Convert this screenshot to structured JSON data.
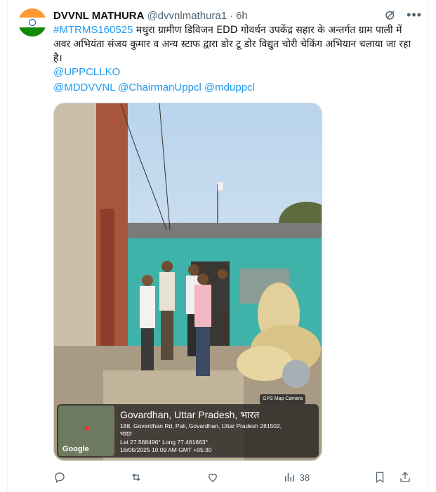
{
  "tweet": {
    "author_name": "DVVNL MATHURA",
    "author_handle": "@dvvnlmathura1",
    "separator": "·",
    "time": "6h",
    "hashtag": "#MTRMS160525",
    "body": "मथुरा ग्रामीण डिविजन EDD गोवर्धन उपकेंद्र सहार के अन्तर्गत ग्राम पाली में अवर अभियंता संजय कुमार व अन्य स्टाफ द्वारा डोर टू डोर विद्युत चोरी चेकिंग अभियान चलाया जा रहा है।",
    "mention_line_1": "@UPPCLLKO",
    "mention_line_2": "@MDDVVNL @ChairmanUppcl @mduppcl"
  },
  "photo_overlay": {
    "badge": "GPS Map Camera",
    "place": "Govardhan, Uttar Pradesh, भारत",
    "address": "188, Goverdhan Rd, Pali, Govardhan, Uttar Pradesh 281502,",
    "address_2": "भारत",
    "latlong": "Lat 27.568496° Long 77.461663°",
    "datetime": "16/05/2025 10:09 AM GMT +05:30",
    "map_logo": "Google"
  },
  "actions": {
    "views_count": "38"
  },
  "colors": {
    "link": "#1d9bf0",
    "muted": "#536471",
    "saffron": "#ff9933",
    "green": "#138808"
  },
  "icons": [
    "grok-icon",
    "more-icon",
    "reply-icon",
    "retweet-icon",
    "like-icon",
    "views-icon",
    "bookmark-icon",
    "share-icon"
  ]
}
